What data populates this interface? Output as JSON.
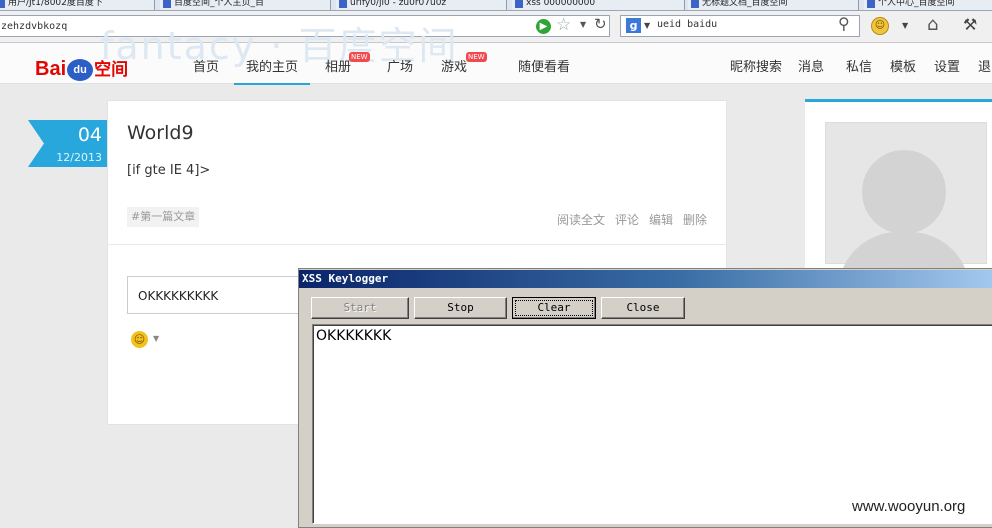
{
  "browser": {
    "tabs": [
      "用户/Jt1/8002度百度下",
      "百度空间_个人主页_百",
      "urlfy0/jl0 - zu0r07u0z",
      "xss 000000000",
      "无标题文档_百度空间",
      "个人中心_百度空间"
    ],
    "url": "zehzdvbkozq",
    "search_engine_letter": "g",
    "search_text": "ueid baidu"
  },
  "site": {
    "logo": {
      "bai": "Bai",
      "du": "du",
      "space": "空间"
    },
    "bg_text": "fantacy · 百度空间",
    "nav": {
      "home": "首页",
      "my_home": "我的主页",
      "album": "相册",
      "plaza": "广场",
      "games": "游戏",
      "browse": "随便看看",
      "new_badge": "NEW"
    },
    "right_nav": {
      "nick_search": "昵称搜索",
      "messages": "消息",
      "private_msg": "私信",
      "templates": "模板",
      "settings": "设置",
      "logout": "退"
    }
  },
  "post": {
    "day": "04",
    "month_year": "12/2013",
    "title": "World9",
    "body": "[if gte IE 4]>",
    "tag": "#第一篇文章",
    "actions": {
      "read_all": "阅读全文",
      "comment": "评论",
      "edit": "编辑",
      "delete": "删除"
    },
    "comment_value": "OKKKKKKKKK"
  },
  "keylogger": {
    "title": "XSS Keylogger",
    "buttons": {
      "start": "Start",
      "stop": "Stop",
      "clear": "Clear",
      "close": "Close"
    },
    "captured_text": "OKKKKKKK"
  },
  "watermark": "www.wooyun.org"
}
